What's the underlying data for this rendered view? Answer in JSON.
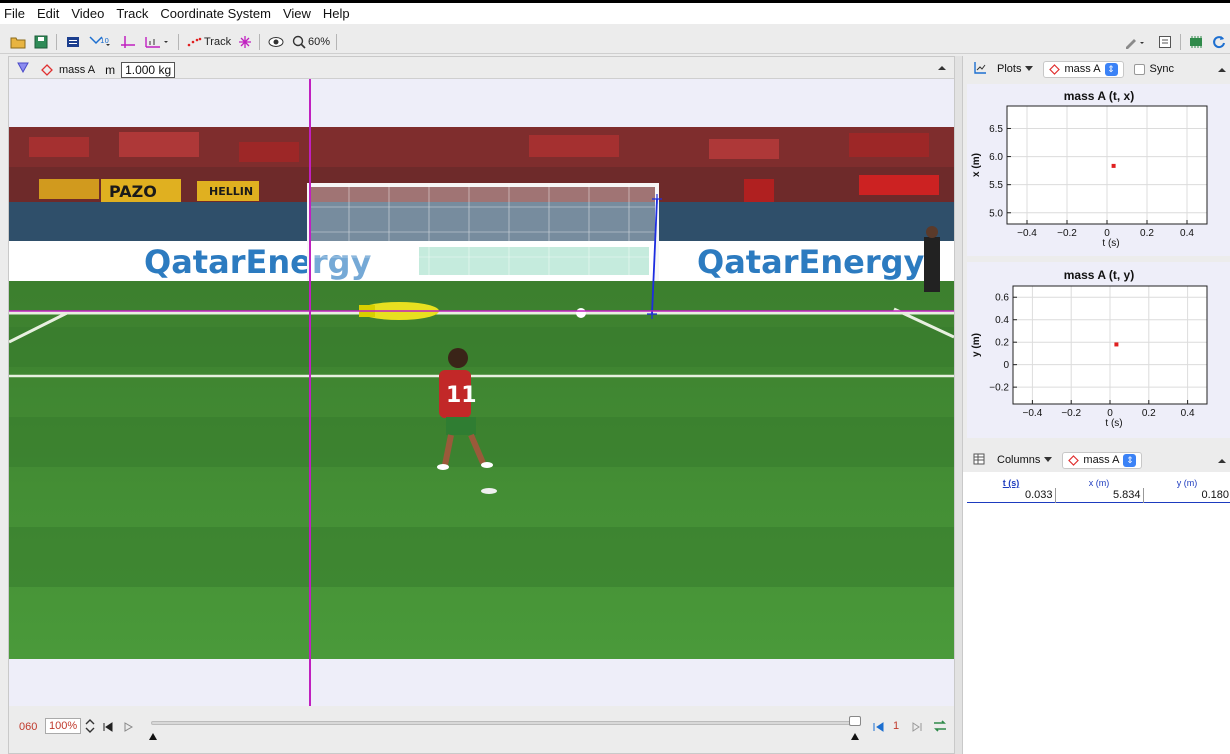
{
  "menu": [
    "File",
    "Edit",
    "Video",
    "Track",
    "Coordinate System",
    "View",
    "Help"
  ],
  "toolbar": {
    "track_label": "Track",
    "zoom_label": "60%"
  },
  "video_header": {
    "mass_name": "mass A",
    "mass_symbol": "m",
    "mass_value": "1.000 kg"
  },
  "playbar": {
    "frame_counter": "060",
    "rate": "100%",
    "step_size": "1"
  },
  "plots_header": {
    "plots_label": "Plots",
    "track_select": "mass A",
    "sync_label": "Sync"
  },
  "plots": [
    {
      "title": "mass A (t, x)",
      "ylabel": "x (m)",
      "xlabel": "t (s)",
      "xticks": [
        "−0.4",
        "−0.2",
        "0",
        "0.2",
        "0.4"
      ],
      "yticks": [
        "6.5",
        "6.0",
        "5.5",
        "5.0"
      ]
    },
    {
      "title": "mass A (t, y)",
      "ylabel": "y (m)",
      "xlabel": "t (s)",
      "xticks": [
        "−0.4",
        "−0.2",
        "0",
        "0.2",
        "0.4"
      ],
      "yticks": [
        "0.6",
        "0.4",
        "0.2",
        "0",
        "−0.2"
      ]
    }
  ],
  "chart_data": [
    {
      "type": "scatter",
      "title": "mass A (t, x)",
      "xlabel": "t (s)",
      "ylabel": "x (m)",
      "xlim": [
        -0.5,
        0.5
      ],
      "ylim": [
        4.8,
        6.9
      ],
      "series": [
        {
          "name": "mass A",
          "x": [
            0.033
          ],
          "y": [
            5.834
          ]
        }
      ]
    },
    {
      "type": "scatter",
      "title": "mass A (t, y)",
      "xlabel": "t (s)",
      "ylabel": "y (m)",
      "xlim": [
        -0.5,
        0.5
      ],
      "ylim": [
        -0.35,
        0.7
      ],
      "series": [
        {
          "name": "mass A",
          "x": [
            0.033
          ],
          "y": [
            0.18
          ]
        }
      ]
    }
  ],
  "table": {
    "columns_label": "Columns",
    "track_select": "mass A",
    "headers": [
      "t (s)",
      "x (m)",
      "y (m)"
    ],
    "rows": [
      [
        "0.033",
        "5.834",
        "0.180"
      ]
    ]
  },
  "video_overlay": {
    "sign_text_1": "QatarEnergy",
    "sign_text_2": "QatarEnergy",
    "banner_1": "PAZO",
    "banner_2": "HELLIN",
    "player_number": "11"
  },
  "colors": {
    "axis_magenta": "#c020c0",
    "tape_blue": "#1d2de0",
    "point_red": "#e02020",
    "pitch_green": "#3f8a35",
    "crowd": "#7a2a2a"
  }
}
